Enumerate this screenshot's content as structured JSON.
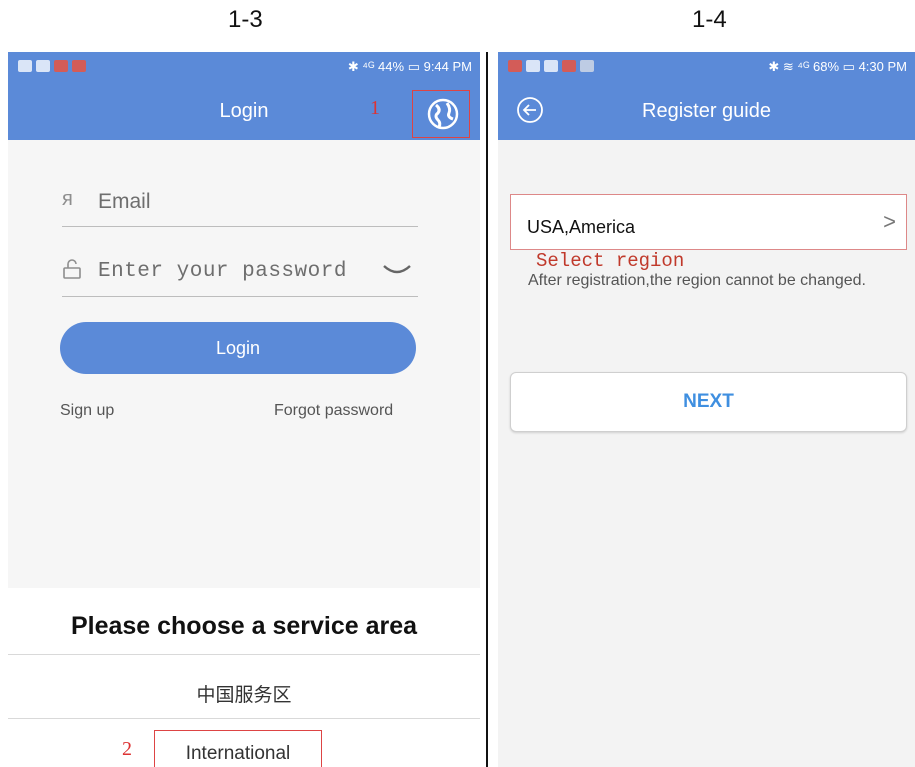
{
  "captions": {
    "left": "1-3",
    "right": "1-4"
  },
  "left": {
    "status_right": "✱ ⁴ᴳ 44% ▭ 9:44 PM",
    "title": "Login",
    "marker_one": "1",
    "email_placeholder": "Email",
    "password_placeholder": "Enter your password",
    "login_button": "Login",
    "sign_up": "Sign up",
    "forgot_password": "Forgot password",
    "sheet": {
      "title": "Please choose a service area",
      "options": [
        "中国服务区",
        "International"
      ],
      "marker_two": "2"
    }
  },
  "right": {
    "status_right": "✱ ≋ ⁴ᴳ 68% ▭ 4:30 PM",
    "title": "Register guide",
    "region_value": "USA,America",
    "chevron": ">",
    "select_region": "Select region",
    "note": "After registration,the region cannot be changed.",
    "next_button": "NEXT"
  },
  "colors": {
    "app_bar": "#5b8ad8",
    "annotation": "#d33333",
    "next_text": "#3f8fe0"
  }
}
